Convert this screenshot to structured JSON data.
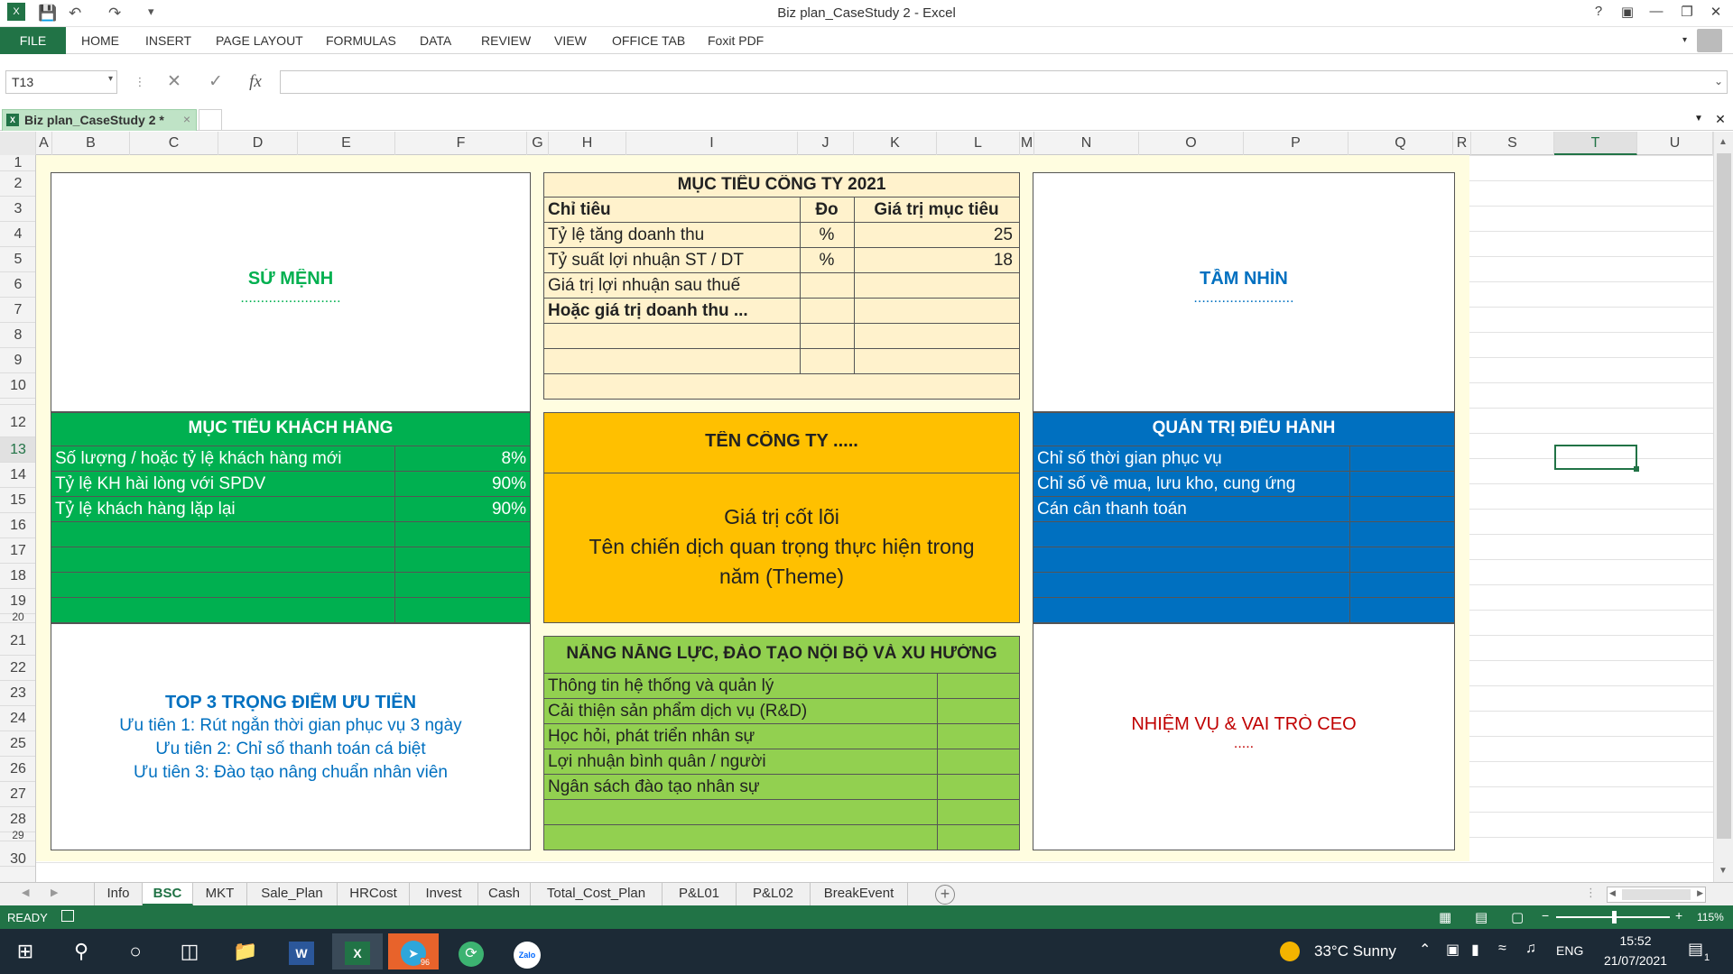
{
  "window": {
    "title": "Biz plan_CaseStudy 2 - Excel",
    "help": "?"
  },
  "ribbon": {
    "file": "FILE",
    "tabs": [
      "HOME",
      "INSERT",
      "PAGE LAYOUT",
      "FORMULAS",
      "DATA",
      "REVIEW",
      "VIEW",
      "OFFICE TAB",
      "Foxit PDF"
    ]
  },
  "formula_bar": {
    "name_box": "T13",
    "fx": "fx",
    "value": ""
  },
  "doc_tab": {
    "label": "Biz plan_CaseStudy 2 *"
  },
  "columns": [
    "A",
    "B",
    "C",
    "D",
    "E",
    "F",
    "G",
    "H",
    "I",
    "J",
    "K",
    "L",
    "M",
    "N",
    "O",
    "P",
    "Q",
    "R",
    "S",
    "T",
    "U"
  ],
  "rows": [
    "1",
    "2",
    "3",
    "4",
    "5",
    "6",
    "7",
    "8",
    "9",
    "10",
    "12",
    "13",
    "14",
    "15",
    "16",
    "17",
    "18",
    "19",
    "20",
    "21",
    "22",
    "23",
    "24",
    "25",
    "26",
    "27",
    "28",
    "29",
    "30"
  ],
  "sheet": {
    "mission": {
      "title": "SỨ MỆNH",
      "dots": "........................."
    },
    "vision": {
      "title": "TẦM NHÌN",
      "dots": "........................."
    },
    "targets": {
      "title": "MỤC TIÊU CÔNG TY 2021",
      "headers": [
        "Chỉ tiêu",
        "Đo",
        "Giá trị mục tiêu"
      ],
      "rows": [
        [
          "Tỷ lệ tăng doanh thu",
          "%",
          "25"
        ],
        [
          "Tỷ suất lợi nhuận ST / DT",
          "%",
          "18"
        ],
        [
          "Giá trị lợi nhuận sau thuế",
          "",
          ""
        ],
        [
          "Hoặc giá trị doanh thu ...",
          "",
          ""
        ]
      ]
    },
    "customer": {
      "title": "MỤC TIÊU KHÁCH HÀNG",
      "rows": [
        [
          "Số lượng / hoặc tỷ lệ khách hàng mới",
          "8%"
        ],
        [
          "Tỷ lệ KH hài lòng với SPDV",
          "90%"
        ],
        [
          "Tỷ lệ khách hàng lặp lại",
          "90%"
        ]
      ]
    },
    "company": {
      "name": "TÊN CÔNG TY  .....",
      "core_line1": "Giá trị cốt lõi",
      "core_line2": "Tên chiến dịch quan trọng thực hiện trong",
      "core_line3": "năm (Theme)"
    },
    "operations": {
      "title": "QUẢN TRỊ ĐIỀU HÀNH",
      "rows": [
        "Chỉ số thời gian phục vụ",
        "Chỉ số về mua, lưu kho, cung ứng",
        "Cán cân thanh toán"
      ]
    },
    "priorities": {
      "title": "TOP 3 TRỌNG ĐIỂM ƯU TIÊN",
      "items": [
        "Ưu tiên 1: Rút ngắn thời gian phục vụ 3 ngày",
        "Ưu tiên 2: Chỉ số thanh toán cá biệt",
        "Ưu tiên 3: Đào tạo nâng chuẩn nhân viên"
      ]
    },
    "learning": {
      "title": "NÂNG NĂNG LỰC, ĐÀO TẠO NỘI BỘ VÀ XU HƯỚNG",
      "rows": [
        "Thông tin hệ thống và quản lý",
        "Cải thiện sản phẩm dịch vụ (R&D)",
        "Học hỏi, phát triển nhân sự",
        "Lợi nhuận bình quân / người",
        "Ngân sách đào tạo nhân sự"
      ]
    },
    "ceo": {
      "title": "NHIỆM VỤ & VAI TRÒ CEO",
      "dots": "....."
    }
  },
  "sheet_tabs": [
    "Info",
    "BSC",
    "MKT",
    "Sale_Plan",
    "HRCost",
    "Invest",
    "Cash",
    "Total_Cost_Plan",
    "P&L01",
    "P&L02",
    "BreakEvent"
  ],
  "active_sheet": "BSC",
  "status": {
    "mode": "READY",
    "zoom": "115%"
  },
  "taskbar": {
    "weather": "33°C  Sunny",
    "lang": "ENG",
    "time": "15:52",
    "date": "21/07/2021",
    "notif": "1",
    "telegram_badge": "96",
    "zalo": "Zalo"
  },
  "colors": {
    "excel_green": "#217346",
    "panel_green": "#00b050",
    "panel_blue": "#0070c0",
    "panel_gold": "#ffc000",
    "panel_light_green": "#92d050",
    "panel_cream": "#fff2cc",
    "text_green": "#00b050",
    "text_blue": "#0070c0",
    "text_red": "#c00000"
  }
}
